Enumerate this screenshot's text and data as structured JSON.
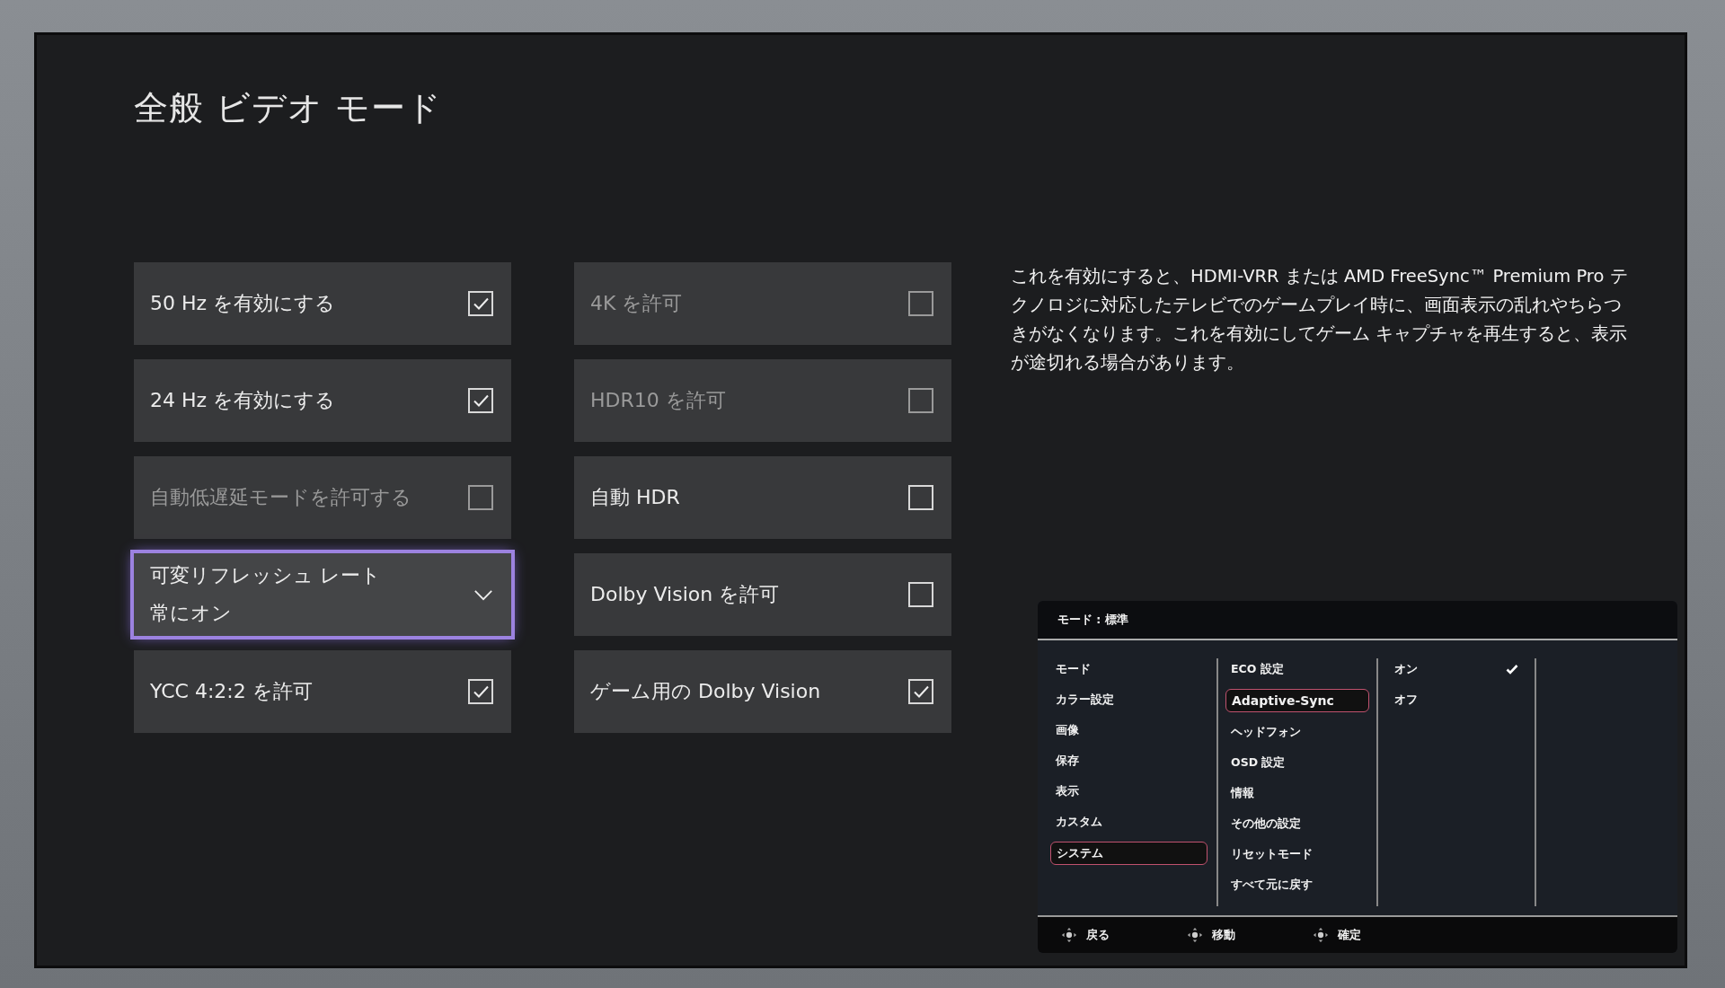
{
  "title": "全般 ビデオ モード",
  "settings": [
    {
      "kind": "checkbox",
      "label": "50 Hz を有効にする",
      "checked": true,
      "disabled": false,
      "selected": false
    },
    {
      "kind": "checkbox",
      "label": "4K を許可",
      "checked": false,
      "disabled": true,
      "selected": false
    },
    {
      "kind": "checkbox",
      "label": "24 Hz を有効にする",
      "checked": true,
      "disabled": false,
      "selected": false
    },
    {
      "kind": "checkbox",
      "label": "HDR10 を許可",
      "checked": false,
      "disabled": true,
      "selected": false
    },
    {
      "kind": "checkbox",
      "label": "自動低遅延モードを許可する",
      "checked": false,
      "disabled": true,
      "selected": false
    },
    {
      "kind": "checkbox",
      "label": "自動 HDR",
      "checked": false,
      "disabled": false,
      "selected": false
    },
    {
      "kind": "dropdown",
      "label": "可変リフレッシュ レート",
      "value": "常にオン",
      "disabled": false,
      "selected": true
    },
    {
      "kind": "checkbox",
      "label": "Dolby Vision を許可",
      "checked": false,
      "disabled": false,
      "selected": false
    },
    {
      "kind": "checkbox",
      "label": "YCC 4:2:2 を許可",
      "checked": true,
      "disabled": false,
      "selected": false
    },
    {
      "kind": "checkbox",
      "label": "ゲーム用の Dolby Vision",
      "checked": true,
      "disabled": false,
      "selected": false
    }
  ],
  "description": "これを有効にすると、HDMI-VRR または AMD FreeSync™ Premium Pro テクノロジに対応したテレビでのゲームプレイ時に、画面表示の乱れやちらつきがなくなります。これを有効にしてゲーム キャプチャを再生すると、表示が途切れる場合があります。",
  "osd": {
    "header": "モード : 標準",
    "menu": [
      {
        "label": "モード",
        "selected": false
      },
      {
        "label": "カラー設定",
        "selected": false
      },
      {
        "label": "画像",
        "selected": false
      },
      {
        "label": "保存",
        "selected": false
      },
      {
        "label": "表示",
        "selected": false
      },
      {
        "label": "カスタム",
        "selected": false
      },
      {
        "label": "システム",
        "selected": true
      }
    ],
    "submenu": [
      {
        "label": "ECO 設定",
        "selected": false
      },
      {
        "label": "Adaptive-Sync",
        "selected": true
      },
      {
        "label": "ヘッドフォン",
        "selected": false
      },
      {
        "label": "OSD 設定",
        "selected": false
      },
      {
        "label": "情報",
        "selected": false
      },
      {
        "label": "その他の設定",
        "selected": false
      },
      {
        "label": "リセットモード",
        "selected": false
      },
      {
        "label": "すべて元に戻す",
        "selected": false
      }
    ],
    "options": [
      {
        "label": "オン",
        "checked": true
      },
      {
        "label": "オフ",
        "checked": false
      }
    ],
    "footer": [
      "戻る",
      "移動",
      "確定"
    ]
  }
}
